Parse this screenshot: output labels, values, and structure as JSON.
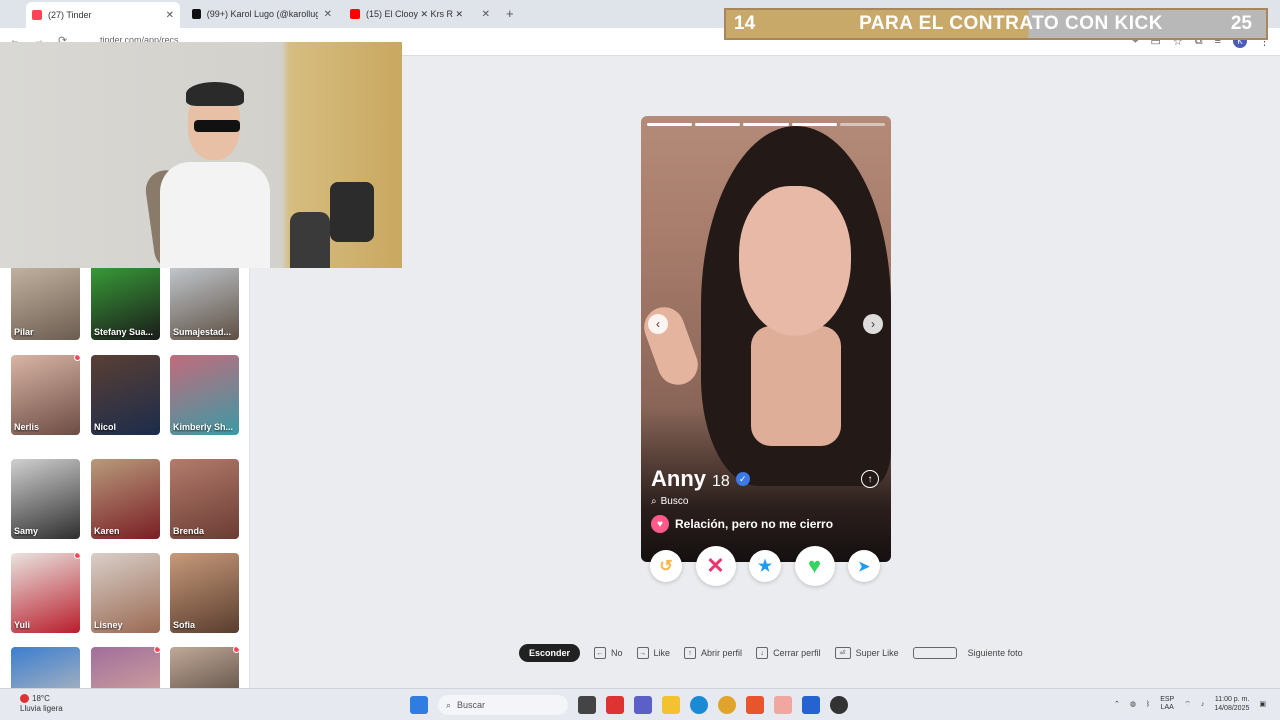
{
  "tabs": [
    {
      "label": "(27) Tinder",
      "color": "#ff4458"
    },
    {
      "label": "(99+) Karol Lugo (@karollugo8)",
      "color": "#111111"
    },
    {
      "label": "(15) El Clooy ✕ Krs R ✕",
      "color": "#ff0000"
    }
  ],
  "address": {
    "url": "tinder.com/app/recs"
  },
  "counter": {
    "left": "14",
    "text": "PARA EL CONTRATO CON KICK",
    "right": "25"
  },
  "matches": [
    {
      "name": "Pilar",
      "colors": [
        "#c9b8a6",
        "#6b5d50"
      ],
      "dot": false
    },
    {
      "name": "Stefany Sua...",
      "colors": [
        "#3aa43a",
        "#1b1b1b"
      ],
      "dot": false
    },
    {
      "name": "Sumajestad...",
      "colors": [
        "#c7cfd6",
        "#5e5044"
      ],
      "dot": false
    },
    {
      "name": "Nerlis",
      "colors": [
        "#d8b5a5",
        "#6d4c44"
      ],
      "dot": true
    },
    {
      "name": "Nicol",
      "colors": [
        "#5a3f33",
        "#1c2c4c"
      ],
      "dot": false
    },
    {
      "name": "Kimberly Sh...",
      "colors": [
        "#c46b7c",
        "#3a9aa5"
      ],
      "dot": false
    },
    {
      "name": "Samy",
      "colors": [
        "#d0d0d0",
        "#2e2e2e"
      ],
      "dot": false
    },
    {
      "name": "Karen",
      "colors": [
        "#b89a7c",
        "#7a1e24"
      ],
      "dot": false
    },
    {
      "name": "Brenda",
      "colors": [
        "#b37c6c",
        "#6b3b33"
      ],
      "dot": false
    },
    {
      "name": "Yuli",
      "colors": [
        "#e9e4e0",
        "#b81e2c"
      ],
      "dot": true
    },
    {
      "name": "Lisney",
      "colors": [
        "#d9cfc9",
        "#9a6a53"
      ],
      "dot": false
    },
    {
      "name": "Sofia",
      "colors": [
        "#c79a7a",
        "#5a3d2e"
      ],
      "dot": false
    },
    {
      "name": "",
      "colors": [
        "#3b7ed0",
        "#d9c9b8"
      ],
      "dot": false
    },
    {
      "name": "",
      "colors": [
        "#a06e9c",
        "#e2b59c"
      ],
      "dot": true
    },
    {
      "name": "",
      "colors": [
        "#c0a998",
        "#3b2d27"
      ],
      "dot": true
    }
  ],
  "profile": {
    "name": "Anny",
    "age": "18",
    "seeking_label": "Busco",
    "relationship": "Relación, pero no me cierro",
    "photo_count": 5,
    "photo_active": 4
  },
  "actions": {
    "rewind": "↺",
    "nope": "✕",
    "super": "★",
    "like": "♥",
    "boost": "➤"
  },
  "shortcuts": {
    "hide": "Esconder",
    "items": [
      {
        "key": "←",
        "label": "No"
      },
      {
        "key": "→",
        "label": "Like"
      },
      {
        "key": "↑",
        "label": "Abrir perfil"
      },
      {
        "key": "↓",
        "label": "Cerrar perfil"
      },
      {
        "key": "⏎",
        "label": "Super Like"
      }
    ],
    "next_photo": "Siguiente foto"
  },
  "taskbar": {
    "temp": "18°C",
    "weather": "Lluvia ligera",
    "search_placeholder": "Buscar",
    "lang_top": "ESP",
    "lang_bottom": "LAA",
    "time": "11:00 p. m.",
    "date": "14/08/2025"
  }
}
